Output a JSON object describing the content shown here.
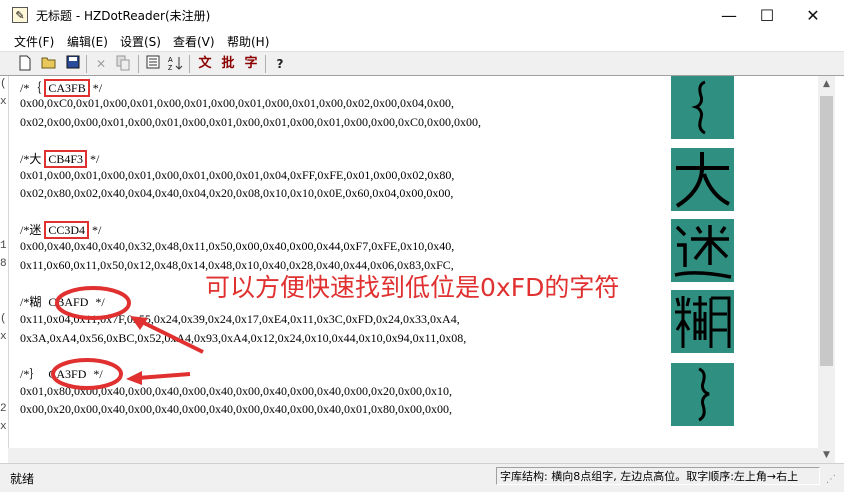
{
  "window": {
    "title": "无标题 - HZDotReader(未注册)",
    "minimize": "—",
    "maximize": "☐",
    "close": "✕"
  },
  "menu": [
    {
      "label": "文件(F)"
    },
    {
      "label": "编辑(E)"
    },
    {
      "label": "设置(S)"
    },
    {
      "label": "查看(V)"
    },
    {
      "label": "帮助(H)"
    }
  ],
  "toolbar": {
    "new": "new-icon",
    "open": "open-icon",
    "save": "save-icon",
    "delete": "delete-icon",
    "copy": "copy-icon",
    "text_a": "文",
    "text_b": "批",
    "text_c": "字",
    "help": "help-icon"
  },
  "entries": [
    {
      "header_pre": "/*｛",
      "code": "CA3FB",
      "header_post": "*/",
      "line1": "0x00,0xC0,0x01,0x00,0x01,0x00,0x01,0x00,0x01,0x00,0x01,0x00,0x02,0x00,0x04,0x00,",
      "line2": "0x02,0x00,0x00,0x01,0x00,0x01,0x00,0x01,0x00,0x01,0x00,0x01,0x00,0x00,0xC0,0x00,0x00,"
    },
    {
      "header_pre": "/*大",
      "code": "CB4F3",
      "header_post": "*/",
      "line1": "0x01,0x00,0x01,0x00,0x01,0x00,0x01,0x00,0x01,0x04,0xFF,0xFE,0x01,0x00,0x02,0x80,",
      "line2": "0x02,0x80,0x02,0x40,0x04,0x40,0x04,0x20,0x08,0x10,0x10,0x0E,0x60,0x04,0x00,0x00,"
    },
    {
      "header_pre": "/*迷",
      "code": "CC3D4",
      "header_post": "*/",
      "line1": "0x00,0x40,0x40,0x40,0x32,0x48,0x11,0x50,0x00,0x40,0x00,0x44,0xF7,0xFE,0x10,0x40,",
      "line2": "0x11,0x60,0x11,0x50,0x12,0x48,0x14,0x48,0x10,0x40,0x28,0x40,0x44,0x06,0x83,0xFC,"
    },
    {
      "header_pre": "/*糊",
      "code": "CBAFD",
      "header_post": "*/",
      "line1": "0x11,0x04,0x11,0x7F,0x55,0x24,0x39,0x24,0x17,0xE4,0x11,0x3C,0xFD,0x24,0x33,0xA4,",
      "line2": "0x3A,0xA4,0x56,0xBC,0x52,0xA4,0x93,0xA4,0x12,0x24,0x10,0x44,0x10,0x94,0x11,0x08,"
    },
    {
      "header_pre": "/*｝",
      "code": "CA3FD",
      "header_post": "*/",
      "line1": "0x01,0x80,0x00,0x40,0x00,0x40,0x00,0x40,0x00,0x40,0x00,0x40,0x00,0x20,0x00,0x10,",
      "line2": "0x00,0x20,0x00,0x40,0x00,0x40,0x00,0x40,0x00,0x40,0x00,0x40,0x01,0x80,0x00,0x00,"
    }
  ],
  "annotation": "可以方便快速找到低位是0xFD的字符",
  "status": {
    "left": "就绪",
    "right": "字库结构: 横向8点组字, 左边点高位。取字顺序:左上角→右上"
  }
}
